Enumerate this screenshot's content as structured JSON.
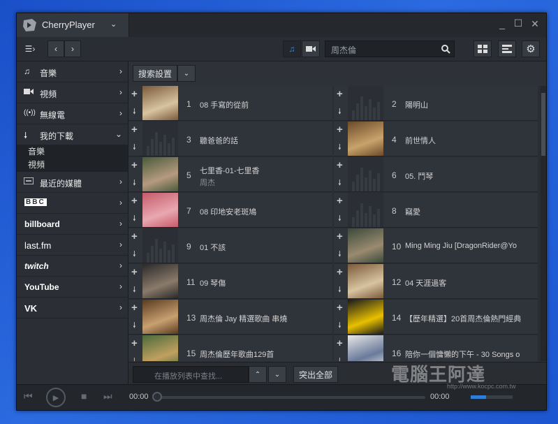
{
  "app": {
    "title": "CherryPlayer"
  },
  "toolbar": {
    "search_value": "周杰倫"
  },
  "sidebar": {
    "items": [
      {
        "label": "音樂",
        "icon": "music-note-icon"
      },
      {
        "label": "視頻",
        "icon": "video-camera-icon"
      },
      {
        "label": "無線電",
        "icon": "radio-waves-icon"
      },
      {
        "label": "我的下載",
        "icon": "download-arrow-icon"
      },
      {
        "label": "最近的媒體",
        "icon": "recent-media-icon"
      }
    ],
    "sub_items": [
      "音樂",
      "視頻"
    ],
    "brands": [
      "BBC",
      "billboard",
      "last.fm",
      "twitch",
      "YouTube",
      "VK"
    ]
  },
  "content": {
    "search_settings_label": "搜索設置",
    "tracks": [
      {
        "num": "1",
        "title": "08 手寫的從前",
        "subtitle": "",
        "has_cover": true
      },
      {
        "num": "2",
        "title": "陽明山",
        "subtitle": "",
        "has_cover": false
      },
      {
        "num": "3",
        "title": "聽爸爸的話",
        "subtitle": "",
        "has_cover": false
      },
      {
        "num": "4",
        "title": "前世情人",
        "subtitle": "",
        "has_cover": true
      },
      {
        "num": "5",
        "title": "七里香-01-七里香",
        "subtitle": "周杰",
        "has_cover": true
      },
      {
        "num": "6",
        "title": "05. 鬥琴",
        "subtitle": "",
        "has_cover": false
      },
      {
        "num": "7",
        "title": "08 印地安老斑鳩",
        "subtitle": "",
        "has_cover": true
      },
      {
        "num": "8",
        "title": "竊愛",
        "subtitle": "",
        "has_cover": false
      },
      {
        "num": "9",
        "title": "01 不該",
        "subtitle": "",
        "has_cover": false
      },
      {
        "num": "10",
        "title": "Ming Ming Jiu [DragonRider@Yo",
        "subtitle": "",
        "has_cover": true
      },
      {
        "num": "11",
        "title": "09 琴傷",
        "subtitle": "",
        "has_cover": true
      },
      {
        "num": "12",
        "title": "04 天涯過客",
        "subtitle": "",
        "has_cover": true
      },
      {
        "num": "13",
        "title": "周杰倫 Jay 精選歌曲 串燒",
        "subtitle": "",
        "has_cover": true
      },
      {
        "num": "14",
        "title": "【歷年精選】20首周杰倫熱門經典",
        "subtitle": "",
        "has_cover": true
      },
      {
        "num": "15",
        "title": "周杰倫歷年歌曲129首",
        "subtitle": "",
        "has_cover": true
      },
      {
        "num": "16",
        "title": "陪你一個慵懶的下午 - 30 Songs o",
        "subtitle": "",
        "has_cover": true
      }
    ],
    "find_placeholder": "在播放列表中查找...",
    "highlight_all_label": "突出全部"
  },
  "player": {
    "time_current": "00:00",
    "time_total": "00:00",
    "volume_level": 0.36
  },
  "watermark": {
    "text": "電腦王阿達",
    "url": "http://www.kocpc.com.tw"
  },
  "colors": {
    "desktop": "#1f5bd6",
    "window": "#2b2f35",
    "accent": "#2f7fd6"
  }
}
